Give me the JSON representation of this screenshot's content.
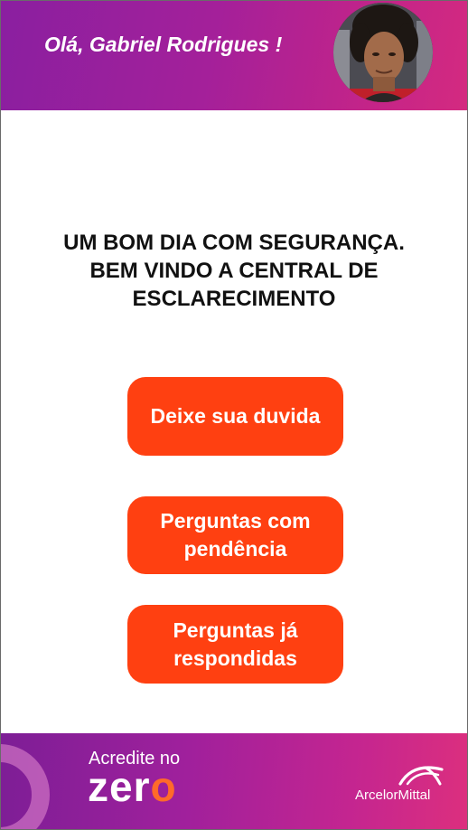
{
  "header": {
    "greeting": "Olá, Gabriel Rodrigues !"
  },
  "main": {
    "title": "UM BOM DIA COM SEGURANÇA.\nBEM VINDO A CENTRAL DE\nESCLARECIMENTO",
    "buttons": [
      {
        "label": "Deixe sua duvida"
      },
      {
        "label": "Perguntas com\npendência"
      },
      {
        "label": "Perguntas já\nrespondidas"
      }
    ]
  },
  "footer": {
    "slogan_top": "Acredite no",
    "slogan_zero_start": "zer",
    "slogan_zero_end": "o",
    "brand": "ArcelorMittal"
  },
  "colors": {
    "header_gradient_start": "#8a1fa0",
    "header_gradient_end": "#d42a80",
    "button": "#ff4011",
    "zero_accent": "#ff6a2a"
  }
}
